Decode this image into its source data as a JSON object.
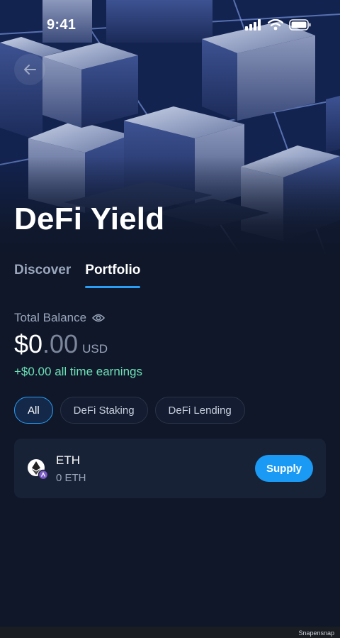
{
  "status_bar": {
    "time": "9:41"
  },
  "hero": {
    "title": "DeFi Yield"
  },
  "tabs": [
    {
      "label": "Discover",
      "active": false
    },
    {
      "label": "Portfolio",
      "active": true
    }
  ],
  "balance": {
    "label": "Total Balance",
    "main": "$0",
    "cents": ".00",
    "unit": "USD",
    "earnings": "+$0.00 all time earnings"
  },
  "filters": [
    {
      "label": "All",
      "active": true
    },
    {
      "label": "DeFi Staking",
      "active": false
    },
    {
      "label": "DeFi Lending",
      "active": false
    }
  ],
  "assets": [
    {
      "name": "ETH",
      "amount": "0 ETH",
      "action": "Supply",
      "icon": "ethereum-icon"
    }
  ],
  "watermark": "Snapensnap",
  "colors": {
    "background": "#0f1729",
    "accent": "#2a9df4",
    "earnings": "#6ee0b6",
    "card": "#182236"
  }
}
